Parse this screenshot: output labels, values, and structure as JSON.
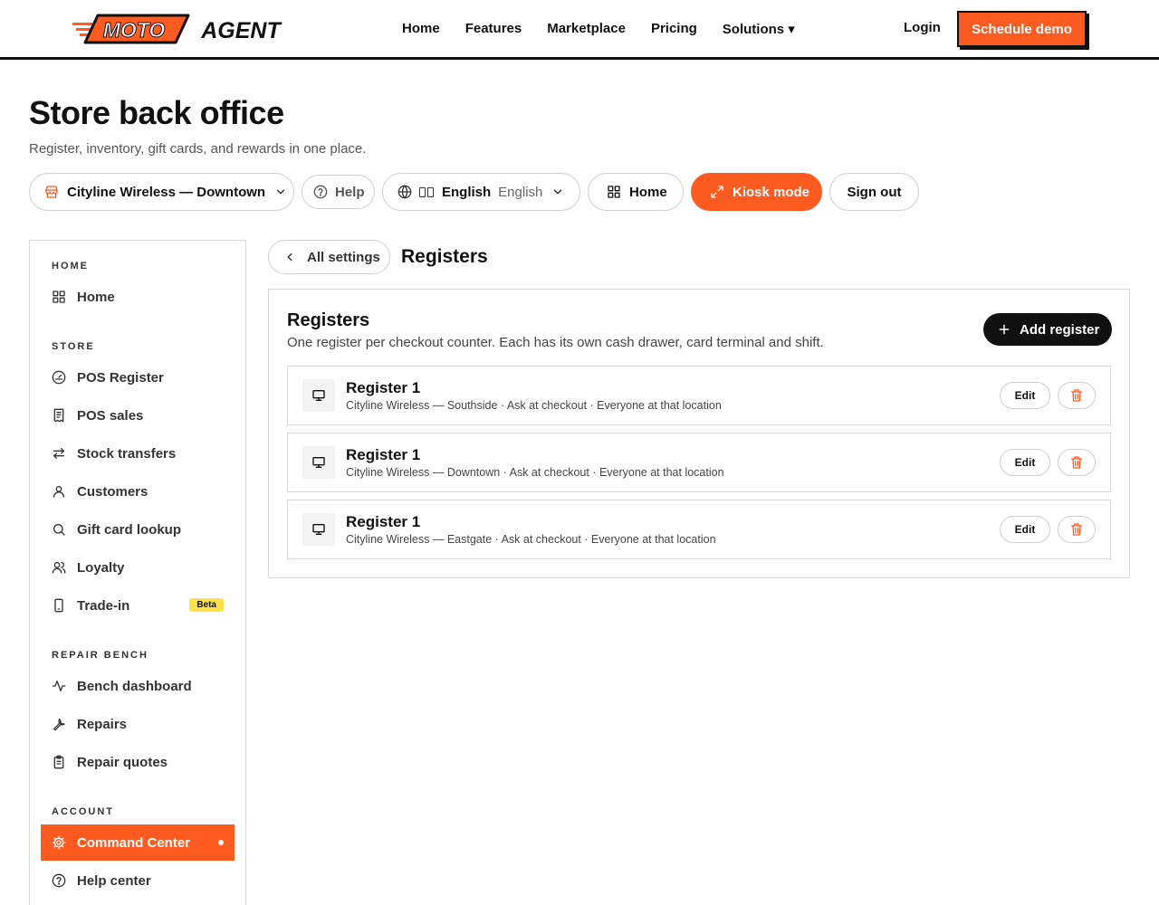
{
  "brand": {
    "logo_text_left": "MOTO",
    "logo_text_right": "AGENT",
    "accent": "#ff5a1f"
  },
  "nav": {
    "links": [
      "Home",
      "Features",
      "Marketplace",
      "Pricing",
      "Solutions ▾"
    ],
    "login": "Login",
    "schedule": "Schedule demo"
  },
  "header": {
    "title": "Store back office",
    "subtitle": "Register, inventory, gift cards, and rewards in one place."
  },
  "toolbar": {
    "store": "Cityline Wireless — Downtown",
    "help": "Help",
    "lang_primary": "English",
    "lang_secondary": "English",
    "home": "Home",
    "kiosk": "Kiosk mode",
    "signout": "Sign out"
  },
  "sidebar": {
    "sections": [
      {
        "label": "HOME",
        "items": [
          {
            "label": "Home",
            "icon": "grid-icon"
          }
        ]
      },
      {
        "label": "STORE",
        "items": [
          {
            "label": "POS Register",
            "icon": "gauge-icon"
          },
          {
            "label": "POS sales",
            "icon": "receipt-icon"
          },
          {
            "label": "Stock transfers",
            "icon": "arrows-swap-icon"
          },
          {
            "label": "Customers",
            "icon": "user-icon"
          },
          {
            "label": "Gift card lookup",
            "icon": "search-icon"
          },
          {
            "label": "Loyalty",
            "icon": "users-icon"
          },
          {
            "label": "Trade-in",
            "icon": "phone-icon",
            "badge": "Beta"
          }
        ]
      },
      {
        "label": "REPAIR BENCH",
        "items": [
          {
            "label": "Bench dashboard",
            "icon": "activity-icon"
          },
          {
            "label": "Repairs",
            "icon": "wrench-icon"
          },
          {
            "label": "Repair quotes",
            "icon": "clipboard-icon"
          }
        ]
      },
      {
        "label": "ACCOUNT",
        "items": [
          {
            "label": "Command Center",
            "icon": "gear-icon",
            "active": true
          },
          {
            "label": "Help center",
            "icon": "help-circle-icon"
          }
        ]
      }
    ]
  },
  "main": {
    "back": "All settings",
    "heading": "Registers",
    "panel_title": "Registers",
    "panel_desc": "One register per checkout counter. Each has its own cash drawer, card terminal and shift.",
    "add": "Add register",
    "edit_label": "Edit",
    "registers": [
      {
        "name": "Register 1",
        "meta": "Cityline Wireless — Southside · Ask at checkout · Everyone at that location"
      },
      {
        "name": "Register 1",
        "meta": "Cityline Wireless — Downtown · Ask at checkout · Everyone at that location"
      },
      {
        "name": "Register 1",
        "meta": "Cityline Wireless — Eastgate · Ask at checkout · Everyone at that location"
      }
    ]
  }
}
